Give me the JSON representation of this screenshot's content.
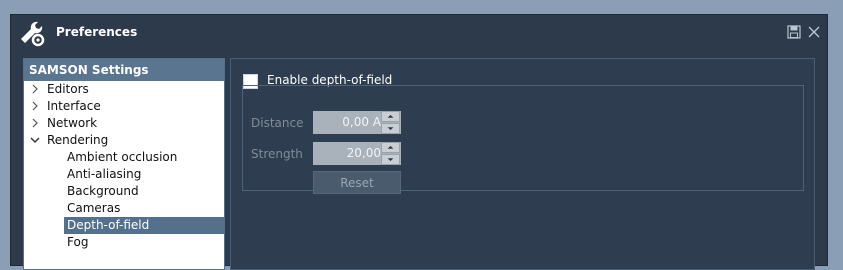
{
  "window": {
    "title": "Preferences",
    "icons": {
      "app": "wrench-gear-icon",
      "save": "floppy-disk-icon",
      "close": "close-icon"
    }
  },
  "sidebar": {
    "header": "SAMSON Settings",
    "items": [
      {
        "label": "Editors",
        "expanded": false
      },
      {
        "label": "Interface",
        "expanded": false
      },
      {
        "label": "Network",
        "expanded": false
      },
      {
        "label": "Rendering",
        "expanded": true,
        "children": [
          {
            "label": "Ambient occlusion"
          },
          {
            "label": "Anti-aliasing"
          },
          {
            "label": "Background"
          },
          {
            "label": "Cameras"
          },
          {
            "label": "Depth-of-field",
            "selected": true
          },
          {
            "label": "Fog"
          }
        ]
      }
    ]
  },
  "panel": {
    "enable_label": "Enable depth-of-field",
    "enable_checked": false,
    "distance": {
      "label": "Distance",
      "value": "0,00 A"
    },
    "strength": {
      "label": "Strength",
      "value": "20,00"
    },
    "reset_label": "Reset"
  },
  "colors": {
    "window_bg": "#2c3a4b",
    "sidebar_header": "#5a7590",
    "selected_item": "#55708c",
    "disabled_text": "#7f8c99"
  }
}
